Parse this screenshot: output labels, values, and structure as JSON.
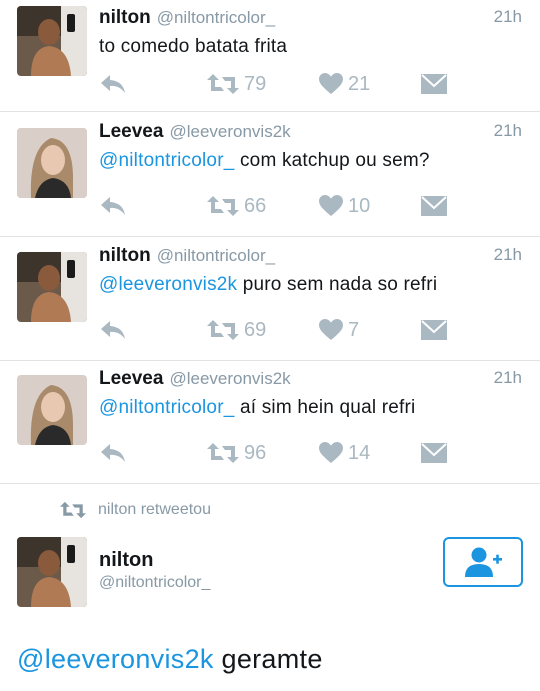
{
  "tweets": [
    {
      "name": "nilton",
      "handle": "@niltontricolor_",
      "time": "21h",
      "mention": "",
      "text": "to comedo batata frita",
      "retweets": "79",
      "likes": "21",
      "avatar": "male"
    },
    {
      "name": "Leevea",
      "handle": "@leeveronvis2k",
      "time": "21h",
      "mention": "@niltontricolor_",
      "text": " com katchup ou sem?",
      "retweets": "66",
      "likes": "10",
      "avatar": "female"
    },
    {
      "name": "nilton",
      "handle": "@niltontricolor_",
      "time": "21h",
      "mention": "@leeveronvis2k",
      "text": " puro sem nada so refri",
      "retweets": "69",
      "likes": "7",
      "avatar": "male"
    },
    {
      "name": "Leevea",
      "handle": "@leeveronvis2k",
      "time": "21h",
      "mention": "@niltontricolor_",
      "text": " aí sim hein qual refri",
      "retweets": "96",
      "likes": "14",
      "avatar": "female"
    }
  ],
  "retweet_note": "nilton retweetou",
  "retweeted": {
    "name": "nilton",
    "handle": "@niltontricolor_",
    "mention": "@leeveronvis2k",
    "text": " geramte",
    "follow_icon": "add-user-icon"
  },
  "colors": {
    "accent": "#1b95e0",
    "icon_gray": "#aab8c2",
    "muted_text": "#8899a6",
    "divider": "#dfe3e6"
  },
  "icons": [
    "reply-icon",
    "retweet-icon",
    "heart-icon",
    "envelope-icon"
  ]
}
